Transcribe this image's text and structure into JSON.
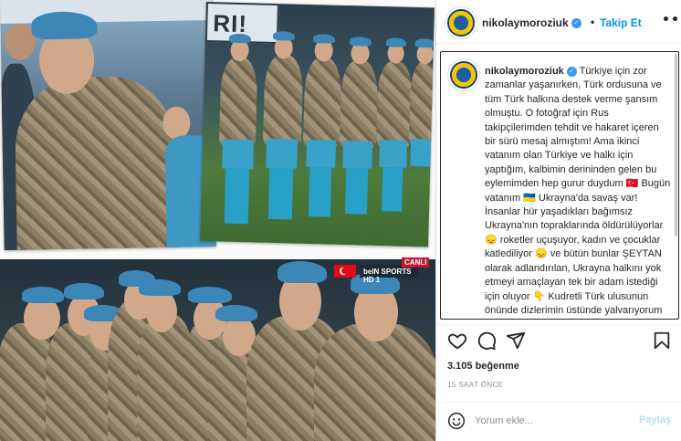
{
  "post": {
    "username": "nikolaymoroziuk",
    "follow_label": "Takip Et",
    "separator": "•",
    "more_label": "•••",
    "verified_mark": "✓",
    "caption": "Türkiye için zor zamanlar yaşanırken, Türk ordusuna ve tüm Türk halkına destek verme şansım olmuştu. O fotoğraf için Rus takipçilerimden tehdit ve hakaret içeren bir sürü mesaj almıştım! Ama ikinci vatanım olan Türkiye ve halkı için yaptığım, kalbimin derininden gelen bu eylemimden hep gurur duydum 🇹🇷 Bugün vatanım 🇺🇦 Ukrayna'da savaş var! İnsanlar hür yaşadıkları bağımsız Ukrayna'nın topraklarında öldürülüyorlar 😞 roketler uçuşuyor, kadın ve çocuklar katlediliyor 😞 ve bütün bunlar ŞEYTAN olarak adlandırılan, Ukrayna halkını yok etmeyi amaçlayan tek bir adam istediği için oluyor 👇 Kudretli Türk ulusunun önünde dizlerimin üstünde yalvarıyorum 🇹🇷 Sizlerin Ukrayna'yı ne kadar çok",
    "likes": "3.105 beğenme",
    "time": "15 SAAT ÖNCE",
    "comment_placeholder": "Yorum ekle...",
    "share_label": "Paylaş"
  },
  "media": {
    "banner_text": "RI!",
    "channel_badge": "CANLI",
    "scorebug": "beIN SPORTS HD 1"
  },
  "icons": {
    "like": "heart-icon",
    "comment": "comment-icon",
    "share": "paper-plane-icon",
    "save": "bookmark-icon",
    "emoji": "smiley-icon",
    "more": "more-icon",
    "verified": "verified-badge-icon"
  },
  "colors": {
    "accent": "#0095f6",
    "verified": "#3897f0",
    "share_disabled": "#b2dffc",
    "beret": "#3c86b8",
    "kit": "#28a0c8"
  }
}
